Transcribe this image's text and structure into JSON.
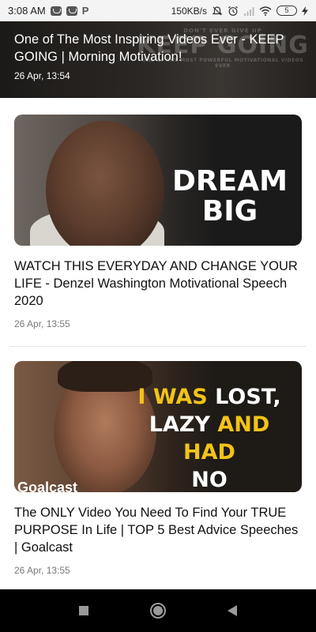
{
  "status_bar": {
    "time": "3:08 AM",
    "left_icons": [
      "notification-box-icon",
      "notification-box-icon",
      "p-icon"
    ],
    "p_label": "P",
    "network_speed": "150KB/s",
    "battery_level": "5",
    "right_icons": [
      "mute-icon",
      "alarm-icon",
      "signal-icon",
      "wifi-icon",
      "battery-icon",
      "charging-icon"
    ]
  },
  "banner": {
    "title": "One of The Most Inspiring Videos Ever - KEEP GOING | Morning Motivation!",
    "date": "26 Apr, 13:54",
    "thumb_small_text": "DON'T EVER GIVE UP",
    "thumb_big_text": "KEEP GOING",
    "thumb_tagline": "ONE OF THE MOST POWERFUL MOTIVATIONAL VIDEOS EVER"
  },
  "cards": [
    {
      "thumb_text_line1": "DREAM",
      "thumb_text_line2": "BIG",
      "title": "WATCH THIS EVERYDAY AND CHANGE YOUR LIFE - Denzel Washington Motivational Speech 2020",
      "date": "26 Apr, 13:55"
    },
    {
      "thumb_words": [
        "I WAS",
        "LOST,",
        "LAZY",
        "AND HAD",
        "NO PURPOSE"
      ],
      "thumb_brand": "Goalcast",
      "title": "The ONLY Video You Need To Find Your TRUE PURPOSE In Life | TOP 5 Best Advice Speeches | Goalcast",
      "date": "26 Apr, 13:55"
    }
  ],
  "nav_bar": {
    "buttons": [
      "recents-icon",
      "home-icon",
      "back-icon"
    ]
  },
  "colors": {
    "accent_yellow": "#f2c318",
    "nav_background": "#000000",
    "date_gray": "#777777"
  }
}
